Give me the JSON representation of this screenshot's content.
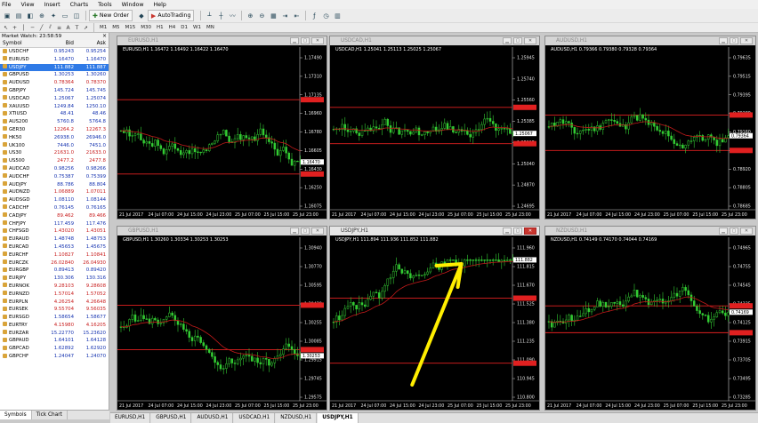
{
  "menu": [
    "File",
    "View",
    "Insert",
    "Charts",
    "Tools",
    "Window",
    "Help"
  ],
  "toolbar": {
    "new_order": "New Order",
    "autotrading": "AutoTrading",
    "timeframes": [
      "M1",
      "M5",
      "M15",
      "M30",
      "H1",
      "H4",
      "D1",
      "W1",
      "MN"
    ]
  },
  "market_watch": {
    "title": "Market Watch: 23:58:59",
    "headers": {
      "symbol": "Symbol",
      "bid": "Bid",
      "ask": "Ask"
    },
    "rows": [
      {
        "s": "USDCHF",
        "b": "0.95243",
        "a": "0.95254"
      },
      {
        "s": "EURUSD",
        "b": "1.16470",
        "a": "1.16470"
      },
      {
        "s": "USDJPY",
        "b": "111.882",
        "a": "111.887",
        "sel": true
      },
      {
        "s": "GBPUSD",
        "b": "1.30253",
        "a": "1.30260"
      },
      {
        "s": "AUDUSD",
        "b": "0.78364",
        "a": "0.78370",
        "dn": true
      },
      {
        "s": "GBPJPY",
        "b": "145.724",
        "a": "145.745"
      },
      {
        "s": "USDCAD",
        "b": "1.25067",
        "a": "1.25074"
      },
      {
        "s": "XAUUSD",
        "b": "1249.84",
        "a": "1250.10"
      },
      {
        "s": "XTIUSD",
        "b": "48.41",
        "a": "48.46"
      },
      {
        "s": "AUS200",
        "b": "5760.8",
        "a": "5764.8"
      },
      {
        "s": "GER30",
        "b": "12264.2",
        "a": "12267.3",
        "dn": true
      },
      {
        "s": "HK50",
        "b": "26938.0",
        "a": "26946.0"
      },
      {
        "s": "UK100",
        "b": "7446.0",
        "a": "7451.0"
      },
      {
        "s": "US30",
        "b": "21631.0",
        "a": "21633.0",
        "dn": true
      },
      {
        "s": "US500",
        "b": "2477.2",
        "a": "2477.8",
        "dn": true
      },
      {
        "s": "AUDCAD",
        "b": "0.98256",
        "a": "0.98266"
      },
      {
        "s": "AUDCHF",
        "b": "0.75387",
        "a": "0.75399"
      },
      {
        "s": "AUDJPY",
        "b": "88.786",
        "a": "88.804"
      },
      {
        "s": "AUDNZD",
        "b": "1.06889",
        "a": "1.07011",
        "dn": true
      },
      {
        "s": "AUDSGD",
        "b": "1.08110",
        "a": "1.08144"
      },
      {
        "s": "CADCHF",
        "b": "0.76145",
        "a": "0.76165"
      },
      {
        "s": "CADJPY",
        "b": "89.462",
        "a": "89.466",
        "dn": true
      },
      {
        "s": "CHFJPY",
        "b": "117.459",
        "a": "117.476"
      },
      {
        "s": "CHFSGD",
        "b": "1.43020",
        "a": "1.43051",
        "dn": true
      },
      {
        "s": "EURAUD",
        "b": "1.48748",
        "a": "1.48753"
      },
      {
        "s": "EURCAD",
        "b": "1.45653",
        "a": "1.45675"
      },
      {
        "s": "EURCHF",
        "b": "1.10827",
        "a": "1.10841",
        "dn": true
      },
      {
        "s": "EURCZK",
        "b": "26.02840",
        "a": "26.04930",
        "dn": true
      },
      {
        "s": "EURGBP",
        "b": "0.89413",
        "a": "0.89420"
      },
      {
        "s": "EURJPY",
        "b": "130.306",
        "a": "130.316"
      },
      {
        "s": "EURNOK",
        "b": "9.28103",
        "a": "9.28608",
        "dn": true
      },
      {
        "s": "EURNZD",
        "b": "1.57014",
        "a": "1.57052",
        "dn": true
      },
      {
        "s": "EURPLN",
        "b": "4.26254",
        "a": "4.26648",
        "dn": true
      },
      {
        "s": "EURSEK",
        "b": "9.55704",
        "a": "9.56035",
        "dn": true
      },
      {
        "s": "EURSGD",
        "b": "1.58654",
        "a": "1.58677"
      },
      {
        "s": "EURTRY",
        "b": "4.15980",
        "a": "4.16205",
        "dn": true
      },
      {
        "s": "EURZAR",
        "b": "15.22770",
        "a": "15.23620"
      },
      {
        "s": "GBPAUD",
        "b": "1.64101",
        "a": "1.64128"
      },
      {
        "s": "GBPCAD",
        "b": "1.62892",
        "a": "1.62920"
      },
      {
        "s": "GBPCHF",
        "b": "1.24047",
        "a": "1.24070"
      }
    ],
    "tabs": [
      "Symbols",
      "Tick Chart"
    ]
  },
  "charts": [
    {
      "id": "eurusd",
      "title": "EURUSD,H1",
      "label": "EURUSD,H1  1.16472 1.16492 1.16422 1.16470",
      "prices": [
        "1.17490",
        "1.17310",
        "1.17135",
        "1.16960",
        "1.16780",
        "1.16605",
        "1.16430",
        "1.16250",
        "1.16075"
      ],
      "times": [
        "21 Jul 2017",
        "24 Jul 07:00",
        "24 Jul 15:00",
        "24 Jul 23:00",
        "25 Jul 07:00",
        "25 Jul 15:00",
        "25 Jul 23:00"
      ],
      "current": "1.16470",
      "seed": 3,
      "trend": -0.2,
      "active": false
    },
    {
      "id": "usdcad",
      "title": "USDCAD,H1",
      "label": "USDCAD,H1  1.25041 1.25113 1.25025 1.25067",
      "prices": [
        "1.25945",
        "1.25740",
        "1.25560",
        "1.25385",
        "1.25215",
        "1.25040",
        "1.24870",
        "1.24695"
      ],
      "times": [
        "21 Jul 2017",
        "24 Jul 07:00",
        "24 Jul 15:00",
        "24 Jul 23:00",
        "25 Jul 07:00",
        "25 Jul 15:00",
        "25 Jul 23:00"
      ],
      "current": "1.25067",
      "seed": 7,
      "trend": -0.6,
      "active": false
    },
    {
      "id": "audusd",
      "title": "AUDUSD,H1",
      "label": "AUDUSD,H1  0.79366 0.79380 0.79328 0.79364",
      "prices": [
        "0.79635",
        "0.79515",
        "0.79395",
        "0.79280",
        "0.79160",
        "0.79040",
        "0.78920",
        "0.78805",
        "0.78685"
      ],
      "times": [
        "21 Jul 2017",
        "24 Jul 07:00",
        "24 Jul 15:00",
        "24 Jul 23:00",
        "25 Jul 07:00",
        "25 Jul 15:00",
        "25 Jul 23:00"
      ],
      "current": "0.79364",
      "seed": 11,
      "trend": 0.1,
      "active": false
    },
    {
      "id": "gbpusd",
      "title": "GBPUSD,H1",
      "label": "GBPUSD,H1  1.30260 1.30334 1.30253 1.30253",
      "prices": [
        "1.30940",
        "1.30770",
        "1.30595",
        "1.30430",
        "1.30255",
        "1.30085",
        "1.29915",
        "1.29745",
        "1.29575"
      ],
      "times": [
        "21 Jul 2017",
        "24 Jul 07:00",
        "24 Jul 15:00",
        "24 Jul 23:00",
        "25 Jul 07:00",
        "25 Jul 15:00",
        "25 Jul 23:00"
      ],
      "current": "1.30253",
      "seed": 5,
      "trend": 0.0,
      "active": false
    },
    {
      "id": "usdjpy",
      "title": "USDJPY,H1",
      "label": "USDJPY,H1  111.894 111.936 111.852 111.882",
      "prices": [
        "111.960",
        "111.815",
        "111.670",
        "111.525",
        "111.380",
        "111.235",
        "111.090",
        "110.945",
        "110.800"
      ],
      "times": [
        "21 Jul 2017",
        "24 Jul 07:00",
        "24 Jul 15:00",
        "24 Jul 23:00",
        "25 Jul 07:00",
        "25 Jul 15:00",
        "25 Jul 23:00"
      ],
      "current": "111.882",
      "seed": 13,
      "trend": 1.2,
      "active": true
    },
    {
      "id": "nzdusd",
      "title": "NZDUSD,H1",
      "label": "NZDUSD,H1  0.74149 0.74170 0.74044 0.74169",
      "prices": [
        "0.74965",
        "0.74755",
        "0.74545",
        "0.74335",
        "0.74125",
        "0.73915",
        "0.73705",
        "0.73495",
        "0.73285"
      ],
      "times": [
        "21 Jul 2017",
        "24 Jul 07:00",
        "24 Jul 15:00",
        "24 Jul 23:00",
        "25 Jul 07:00",
        "25 Jul 15:00",
        "25 Jul 23:00"
      ],
      "current": "0.74169",
      "seed": 17,
      "trend": -0.3,
      "active": false
    }
  ],
  "bottom_tabs": [
    "EURUSD,H1",
    "GBPUSD,H1",
    "AUDUSD,H1",
    "USDCAD,H1",
    "NZDUSD,H1",
    "USDJPY,H1"
  ],
  "colors": {
    "bull": "#33cc33",
    "bear": "#33cc33",
    "ma": "#c21a1a",
    "level": "#e02020",
    "arrow": "#ffee00"
  }
}
